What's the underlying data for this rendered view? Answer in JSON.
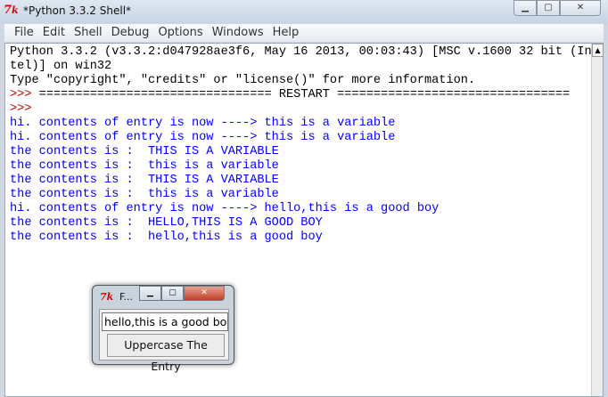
{
  "window": {
    "title": "*Python 3.3.2 Shell*",
    "icon": "tk-icon"
  },
  "menu": [
    "File",
    "Edit",
    "Shell",
    "Debug",
    "Options",
    "Windows",
    "Help"
  ],
  "shell_lines": [
    {
      "text": "Python 3.3.2 (v3.3.2:d047928ae3f6, May 16 2013, 00:03:43) [MSC v.1600 32 bit (In",
      "color": "blk"
    },
    {
      "text": "tel)] on win32",
      "color": "blk"
    },
    {
      "text": "Type \"copyright\", \"credits\" or \"license()\" for more information.",
      "color": "blk"
    },
    {
      "text": "================================ RESTART ================================",
      "color": "blk",
      "prompt": ">>> "
    },
    {
      "text": "",
      "color": "blk",
      "prompt": ">>> "
    },
    {
      "text": "hi. contents of entry is now ----> this is a variable",
      "color": "blu"
    },
    {
      "text": "hi. contents of entry is now ----> this is a variable",
      "color": "blu"
    },
    {
      "text": "the contents is :  THIS IS A VARIABLE",
      "color": "blu"
    },
    {
      "text": "the contents is :  this is a variable",
      "color": "blu"
    },
    {
      "text": "the contents is :  THIS IS A VARIABLE",
      "color": "blu"
    },
    {
      "text": "the contents is :  this is a variable",
      "color": "blu"
    },
    {
      "text": "hi. contents of entry is now ----> hello,this is a good boy",
      "color": "blu"
    },
    {
      "text": "the contents is :  HELLO,THIS IS A GOOD BOY",
      "color": "blu"
    },
    {
      "text": "the contents is :  hello,this is a good boy",
      "color": "blu"
    }
  ],
  "dialog": {
    "title": "F...",
    "entry_value": "hello,this is a good boy",
    "button": "Uppercase The Entry"
  }
}
